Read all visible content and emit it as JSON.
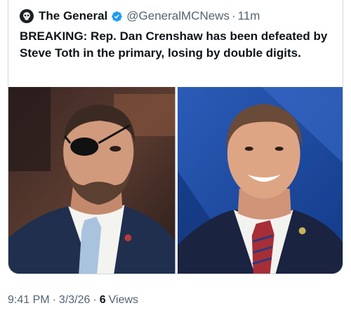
{
  "quoted_tweet": {
    "author_name": "The General",
    "handle": "@GeneralMCNews",
    "separator": "·",
    "time_ago": "11m",
    "text": "BREAKING: Rep. Dan Crenshaw has been defeated by Steve Toth in the primary, losing by double digits.",
    "icons": {
      "avatar": "skull-avatar-icon",
      "verified": "verified-badge-icon"
    },
    "colors": {
      "verified_badge": "#1d9bf0",
      "secondary_text": "#536471",
      "primary_text": "#0f1419",
      "card_border": "#cfd9de"
    }
  },
  "media": {
    "photos": [
      "left-photo",
      "right-photo"
    ]
  },
  "tweet_meta": {
    "time": "9:41 PM",
    "date": "3/3/26",
    "dot": "·",
    "views_count": "6",
    "views_label": "Views"
  }
}
